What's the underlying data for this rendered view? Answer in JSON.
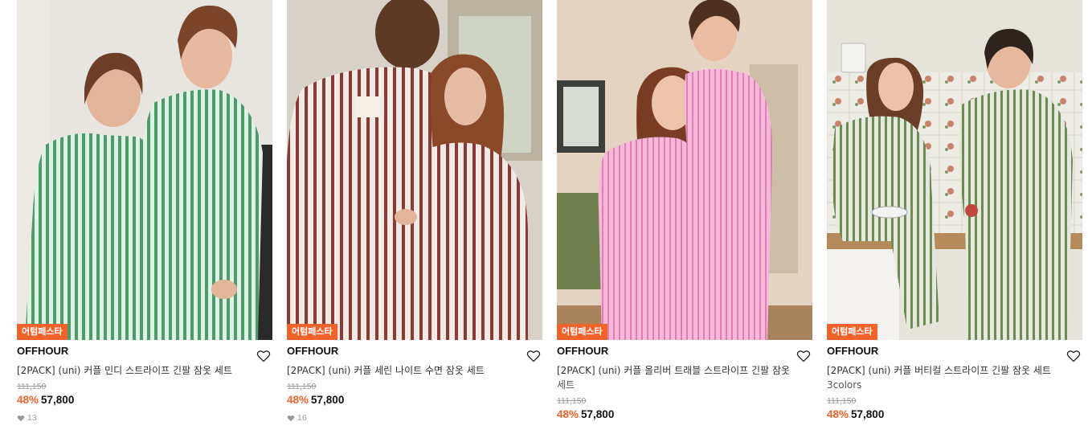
{
  "products": [
    {
      "badge": "어텀페스타",
      "brand": "OFFHOUR",
      "name": "[2PACK] (uni) 커플 민디 스트라이프 긴팔 잠옷 세트",
      "subname": "",
      "original_price": "111,150",
      "discount": "48%",
      "price": "57,800",
      "likes": "13",
      "colors": {
        "accent": "#7fbf9a",
        "stripe": "#3f8e5c",
        "bg": "#e9e6e1"
      }
    },
    {
      "badge": "어텀페스타",
      "brand": "OFFHOUR",
      "name": "[2PACK] (uni) 커플 세린 나이트 수면 잠옷 세트",
      "subname": "",
      "original_price": "111,150",
      "discount": "48%",
      "price": "57,800",
      "likes": "16",
      "colors": {
        "accent": "#efe7df",
        "stripe": "#8a3a34",
        "bg": "#d9d2c9"
      }
    },
    {
      "badge": "어텀페스타",
      "brand": "OFFHOUR",
      "name": "[2PACK] (uni) 커플 올리버 트래블 스트라이프 긴팔 잠옷",
      "subname": "세트",
      "original_price": "111,150",
      "discount": "48%",
      "price": "57,800",
      "likes": "",
      "colors": {
        "accent": "#f1a6cf",
        "stripe": "#e27fb7",
        "bg": "#e6d7c7"
      }
    },
    {
      "badge": "어텀페스타",
      "brand": "OFFHOUR",
      "name": "[2PACK] (uni) 커플 버티컬 스트라이프 긴팔 잠옷 세트",
      "subname": "3colors",
      "original_price": "111,150",
      "discount": "48%",
      "price": "57,800",
      "likes": "",
      "colors": {
        "accent": "#d9e0cf",
        "stripe": "#6f8a57",
        "bg": "#e7e4da"
      }
    }
  ],
  "icons": {
    "wishlist": "heart-outline-icon",
    "likes": "heart-filled-icon"
  },
  "theme": {
    "sale": "#f4622b",
    "text": "#111111",
    "muted": "#999999"
  }
}
